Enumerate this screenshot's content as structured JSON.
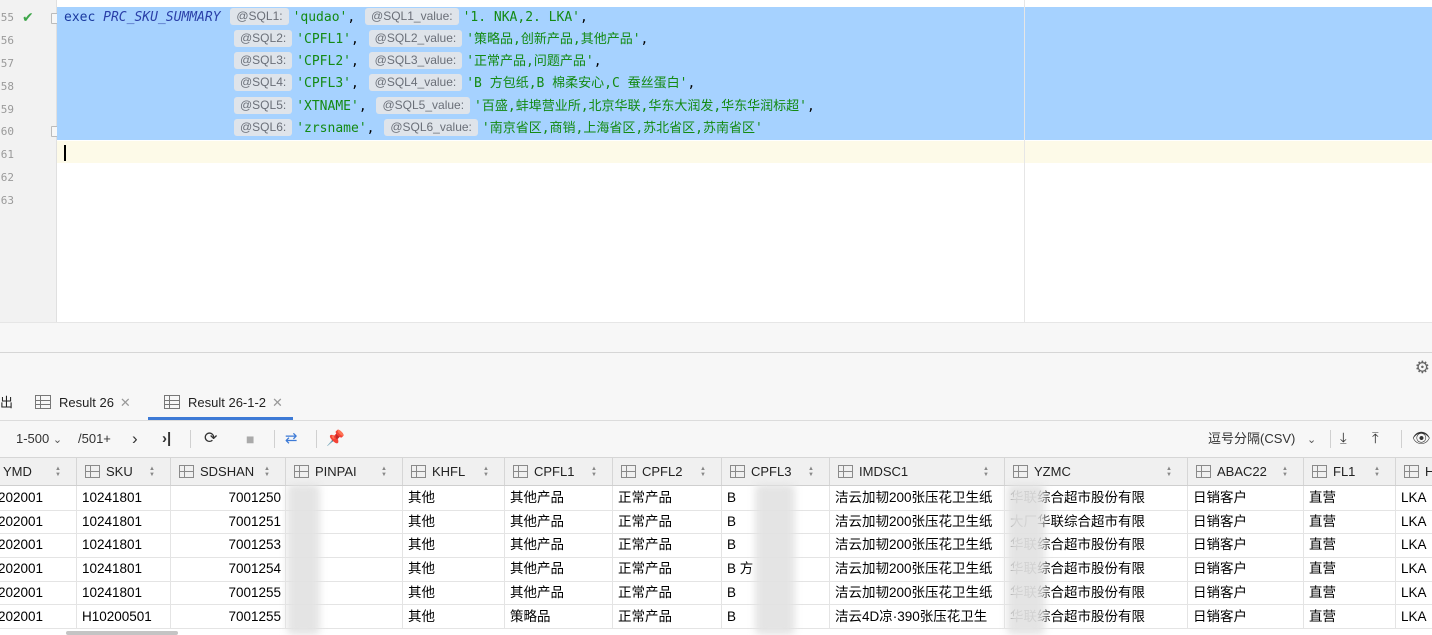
{
  "editor": {
    "line_numbers": [
      "55",
      "56",
      "57",
      "58",
      "59",
      "60",
      "61",
      "62",
      "63"
    ],
    "lines": [
      {
        "prefix_kw": "exec",
        "proc": "PRC_SKU_SUMMARY",
        "params": [
          {
            "hint": "@SQL1:",
            "val": "'qudao'"
          },
          {
            "hint": "@SQL1_value:",
            "val": "'1. NKA,2. LKA'"
          }
        ]
      },
      {
        "params": [
          {
            "hint": "@SQL2:",
            "val": "'CPFL1'"
          },
          {
            "hint": "@SQL2_value:",
            "val": "'策略品,创新产品,其他产品'"
          }
        ]
      },
      {
        "params": [
          {
            "hint": "@SQL3:",
            "val": "'CPFL2'"
          },
          {
            "hint": "@SQL3_value:",
            "val": "'正常产品,问题产品'"
          }
        ]
      },
      {
        "params": [
          {
            "hint": "@SQL4:",
            "val": "'CPFL3'"
          },
          {
            "hint": "@SQL4_value:",
            "val": "'B 方包纸,B 棉柔安心,C 蚕丝蛋白'"
          }
        ]
      },
      {
        "params": [
          {
            "hint": "@SQL5:",
            "val": "'XTNAME'"
          },
          {
            "hint": "@SQL5_value:",
            "val": "'百盛,蚌埠营业所,北京华联,华东大润发,华东华润标超'"
          }
        ]
      },
      {
        "params": [
          {
            "hint": "@SQL6:",
            "val": "'zrsname'"
          },
          {
            "hint": "@SQL6_value:",
            "val": "'南京省区,商销,上海省区,苏北省区,苏南省区'"
          }
        ],
        "last": true
      }
    ]
  },
  "tabs": {
    "partial_label": "出",
    "items": [
      {
        "label": "Result 26",
        "active": false
      },
      {
        "label": "Result 26-1-2",
        "active": true
      }
    ]
  },
  "toolbar": {
    "range": "1-500",
    "total": "/501+",
    "export_format": "逗号分隔(CSV)"
  },
  "grid": {
    "columns": [
      {
        "name": "YMD"
      },
      {
        "name": "SKU"
      },
      {
        "name": "SDSHAN"
      },
      {
        "name": "PINPAI"
      },
      {
        "name": "KHFL"
      },
      {
        "name": "CPFL1"
      },
      {
        "name": "CPFL2"
      },
      {
        "name": "CPFL3"
      },
      {
        "name": "IMDSC1"
      },
      {
        "name": "YZMC"
      },
      {
        "name": "ABAC22"
      },
      {
        "name": "FL1"
      },
      {
        "name": "H"
      }
    ],
    "rows": [
      [
        "202001",
        "10241801",
        "7001250",
        "",
        "其他",
        "其他产品",
        "正常产品",
        "B",
        "洁云加韧200张压花卫生纸",
        "华联综合超市股份有限",
        "日销客户",
        "直营",
        "LKA"
      ],
      [
        "202001",
        "10241801",
        "7001251",
        "",
        "其他",
        "其他产品",
        "正常产品",
        "B",
        "洁云加韧200张压花卫生纸",
        "大厂华联综合超市有限",
        "日销客户",
        "直营",
        "LKA"
      ],
      [
        "202001",
        "10241801",
        "7001253",
        "",
        "其他",
        "其他产品",
        "正常产品",
        "B",
        "洁云加韧200张压花卫生纸",
        "华联综合超市股份有限",
        "日销客户",
        "直营",
        "LKA"
      ],
      [
        "202001",
        "10241801",
        "7001254",
        "",
        "其他",
        "其他产品",
        "正常产品",
        "B 方",
        "洁云加韧200张压花卫生纸",
        "华联综合超市股份有限",
        "日销客户",
        "直营",
        "LKA"
      ],
      [
        "202001",
        "10241801",
        "7001255",
        "",
        "其他",
        "其他产品",
        "正常产品",
        "B",
        "洁云加韧200张压花卫生纸",
        "华联综合超市股份有限",
        "日销客户",
        "直营",
        "LKA"
      ],
      [
        "202001",
        "H10200501",
        "7001255",
        "",
        "其他",
        "策略品",
        "正常产品",
        "B",
        "洁云4D凉·390张压花卫生",
        "华联综合超市股份有限",
        "日销客户",
        "直营",
        "LKA"
      ]
    ]
  }
}
